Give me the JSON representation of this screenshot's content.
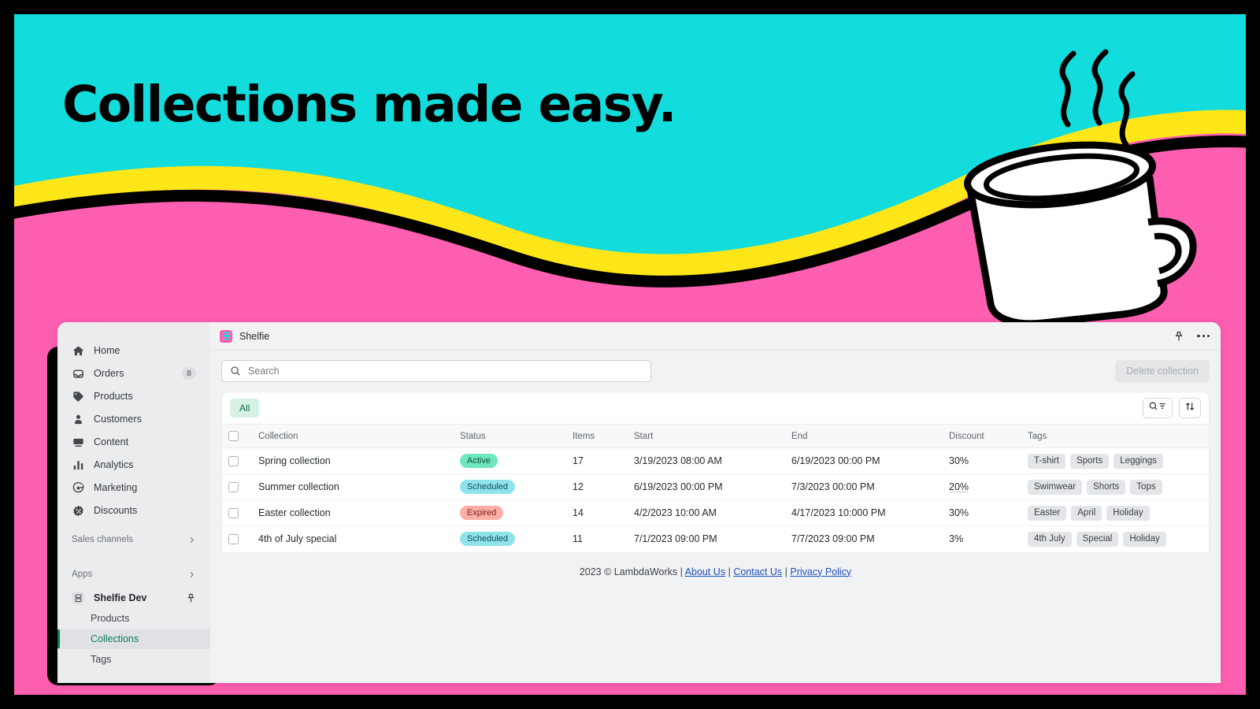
{
  "hero": {
    "title": "Collections made easy.",
    "colors": {
      "cyan": "#13DCDC",
      "pink": "#FF5FB0",
      "yellow": "#FFE619",
      "black": "#000000",
      "mug": "#FFFFFF"
    },
    "illustration": "coffee-mug-with-steam"
  },
  "sidebar": {
    "items": [
      {
        "label": "Home",
        "icon": "home-icon",
        "badge": null
      },
      {
        "label": "Orders",
        "icon": "inbox-icon",
        "badge": "8"
      },
      {
        "label": "Products",
        "icon": "tag-icon",
        "badge": null
      },
      {
        "label": "Customers",
        "icon": "person-icon",
        "badge": null
      },
      {
        "label": "Content",
        "icon": "media-icon",
        "badge": null
      },
      {
        "label": "Analytics",
        "icon": "bar-chart-icon",
        "badge": null
      },
      {
        "label": "Marketing",
        "icon": "megaphone-icon",
        "badge": null
      },
      {
        "label": "Discounts",
        "icon": "discount-icon",
        "badge": null
      }
    ],
    "sections": [
      {
        "label": "Sales channels",
        "icon": "chevron-right-icon"
      },
      {
        "label": "Apps",
        "icon": "chevron-right-icon"
      }
    ],
    "app": {
      "name": "Shelfie Dev",
      "icon": "shelfie-app-icon",
      "pin_icon": "pin-icon",
      "children": [
        {
          "label": "Products",
          "active": false
        },
        {
          "label": "Collections",
          "active": true
        },
        {
          "label": "Tags",
          "active": false
        }
      ]
    },
    "active_accent": "#0F7B5F"
  },
  "titlebar": {
    "brand": "Shelfie",
    "logo_icon": "shelfie-logo-icon",
    "pin_icon": "pin-icon",
    "overflow_icon": "ellipsis-icon"
  },
  "toolbar": {
    "search_placeholder": "Search",
    "search_value": "",
    "search_icon": "search-icon",
    "delete_label": "Delete collection"
  },
  "tabs": {
    "all_label": "All",
    "filter_icon": "search-filter-icon",
    "sort_icon": "sort-icon"
  },
  "table": {
    "columns": [
      "Collection",
      "Status",
      "Items",
      "Start",
      "End",
      "Discount",
      "Tags"
    ],
    "rows": [
      {
        "name": "Spring collection",
        "status": "Active",
        "status_kind": "active",
        "items": "17",
        "start": "3/19/2023 08:00 AM",
        "end": "6/19/2023 00:00 PM",
        "discount": "30%",
        "discount_underline": false,
        "tags": [
          "T-shirt",
          "Sports",
          "Leggings"
        ]
      },
      {
        "name": "Summer collection",
        "status": "Scheduled",
        "status_kind": "scheduled",
        "items": "12",
        "start": "6/19/2023 00:00 PM",
        "end": "7/3/2023 00:00 PM",
        "discount": "20%",
        "discount_underline": true,
        "tags": [
          "Swimwear",
          "Shorts",
          "Tops"
        ]
      },
      {
        "name": "Easter collection",
        "status": "Expired",
        "status_kind": "expired",
        "items": "14",
        "start": "4/2/2023 10:00 AM",
        "end": "4/17/2023 10:000 PM",
        "discount": "30%",
        "discount_underline": false,
        "tags": [
          "Easter",
          "April",
          "Holiday"
        ]
      },
      {
        "name": "4th of July special",
        "status": "Scheduled",
        "status_kind": "scheduled",
        "items": "11",
        "start": " 7/1/2023 09:00 PM",
        "end": "7/7/2023 09:00 PM",
        "discount": "3%",
        "discount_underline": false,
        "tags": [
          "4th July",
          "Special",
          "Holiday"
        ]
      }
    ]
  },
  "footer": {
    "copyright": "2023 © LambdaWorks",
    "links": [
      "About Us",
      "Contact Us",
      "Privacy Policy"
    ],
    "separator": "|"
  }
}
